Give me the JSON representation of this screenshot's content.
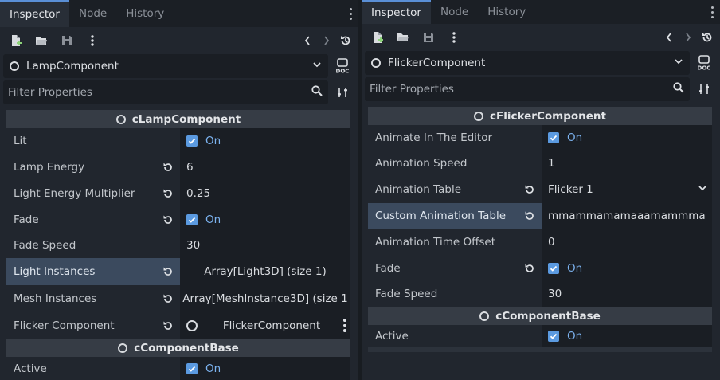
{
  "left": {
    "tabs": [
      "Inspector",
      "Node",
      "History"
    ],
    "selected_node": "LampComponent",
    "filter_placeholder": "Filter Properties",
    "sections": [
      {
        "title": "cLampComponent",
        "rows": [
          {
            "label": "Lit",
            "type": "check",
            "value": "On",
            "revert": false
          },
          {
            "label": "Lamp Energy",
            "type": "text",
            "value": "6",
            "revert": true
          },
          {
            "label": "Light Energy Multiplier",
            "type": "text",
            "value": "0.25",
            "revert": true
          },
          {
            "label": "Fade",
            "type": "check",
            "value": "On",
            "revert": true
          },
          {
            "label": "Fade Speed",
            "type": "text",
            "value": "30",
            "revert": false
          },
          {
            "label": "Light Instances",
            "type": "array",
            "value": "Array[Light3D] (size 1)",
            "revert": true,
            "highlight": true
          },
          {
            "label": "Mesh Instances",
            "type": "array",
            "value": "Array[MeshInstance3D] (size 1",
            "revert": true
          },
          {
            "label": "Flicker Component",
            "type": "resource",
            "value": "FlickerComponent",
            "revert": true
          }
        ]
      },
      {
        "title": "cComponentBase",
        "rows": [
          {
            "label": "Active",
            "type": "check",
            "value": "On",
            "revert": false
          }
        ]
      }
    ]
  },
  "right": {
    "tabs": [
      "Inspector",
      "Node",
      "History"
    ],
    "selected_node": "FlickerComponent",
    "filter_placeholder": "Filter Properties",
    "sections": [
      {
        "title": "cFlickerComponent",
        "rows": [
          {
            "label": "Animate In The Editor",
            "type": "check",
            "value": "On",
            "revert": false
          },
          {
            "label": "Animation Speed",
            "type": "text",
            "value": "1",
            "revert": false
          },
          {
            "label": "Animation Table",
            "type": "dropdown",
            "value": "Flicker 1",
            "revert": true
          },
          {
            "label": "Custom Animation Table",
            "type": "text",
            "value": "mmammamamaaamammma",
            "revert": true,
            "highlight": true
          },
          {
            "label": "Animation Time Offset",
            "type": "text",
            "value": "0",
            "revert": false
          },
          {
            "label": "Fade",
            "type": "check",
            "value": "On",
            "revert": true
          },
          {
            "label": "Fade Speed",
            "type": "text",
            "value": "30",
            "revert": false
          }
        ]
      },
      {
        "title": "cComponentBase",
        "rows": [
          {
            "label": "Active",
            "type": "check",
            "value": "On",
            "revert": false
          }
        ]
      }
    ]
  },
  "colors": {
    "accent": "#5a8fd6",
    "checkbox": "#5b9ae0",
    "on_text": "#7cb3f0",
    "highlight_row": "#3b4a5e"
  },
  "icons": {
    "toolbar": [
      "new-resource-icon",
      "open-folder-icon",
      "save-icon",
      "more-vert-icon"
    ],
    "nav": [
      "chevron-left-icon",
      "chevron-right-icon",
      "history-icon"
    ],
    "doc": "doc-icon",
    "search": "search-icon",
    "filter_options": "tools-icon",
    "revert": "revert-icon"
  }
}
